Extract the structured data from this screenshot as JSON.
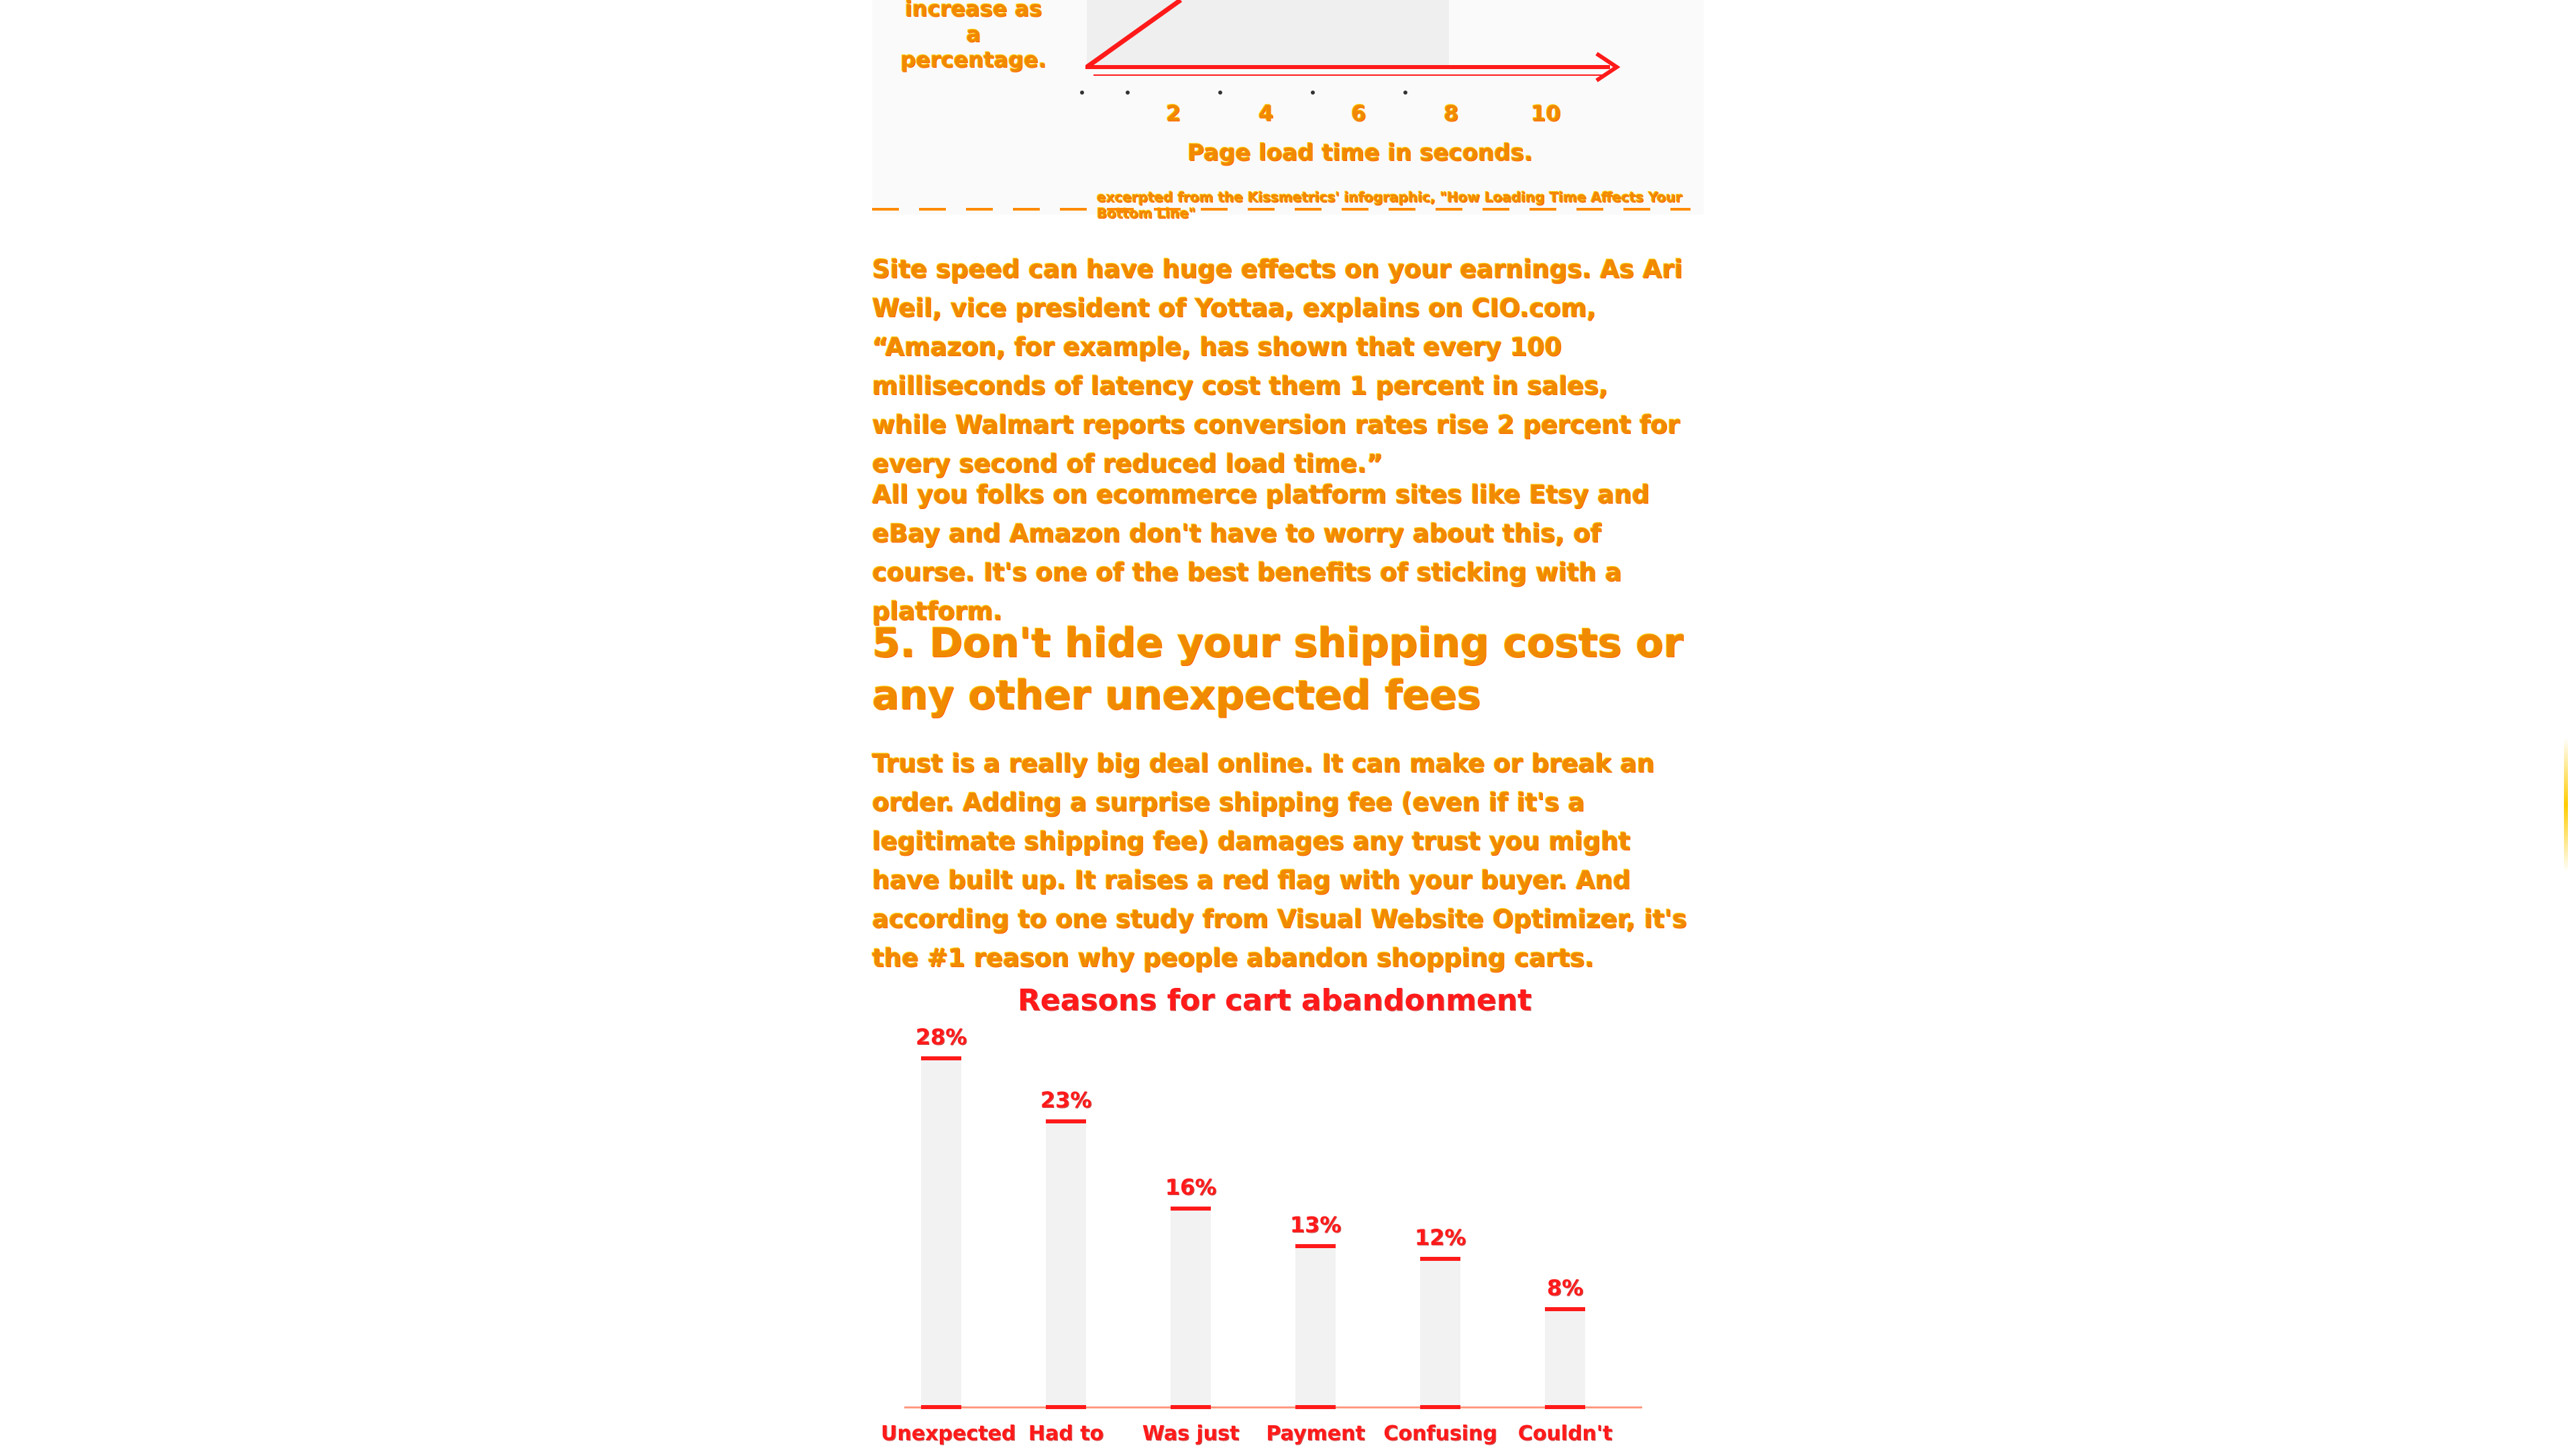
{
  "top_chart": {
    "ylabel_line1": "increase as a",
    "ylabel_line2": "percentage.",
    "x_ticks": [
      "2",
      "4",
      "6",
      "8",
      "10"
    ],
    "xlabel": "Page load time in seconds.",
    "source": "excerpted from the Kissmetrics' infographic, \"How Loading Time Affects Your Bottom Line\""
  },
  "article": {
    "para1": "Site speed can have huge effects on your earnings. As Ari Weil, vice president of Yottaa, explains on CIO.com, “Amazon, for example, has shown that every 100 milliseconds of latency cost them 1 percent in sales, while Walmart reports conversion rates rise 2 percent for every second of reduced load time.”",
    "para2": "All you folks on ecommerce platform sites like Etsy and eBay and Amazon don't have to worry about this, of course. It's one of the best benefits of sticking with a platform.",
    "heading": "5. Don't hide your shipping costs or any other unexpected fees",
    "para3": "Trust is a really big deal online. It can make or break an order. Adding a surprise shipping fee (even if it's a legitimate shipping fee) damages any trust you might have built up. It raises a red flag with your buyer. And according to one study from Visual Website Optimizer, it's the #1 reason why people abandon shopping carts."
  },
  "chart_data": {
    "type": "bar",
    "title": "Reasons for cart abandonment",
    "categories": [
      "Unexpected",
      "Had to",
      "Was just",
      "Payment",
      "Confusing",
      "Couldn't find"
    ],
    "values": [
      28,
      23,
      16,
      13,
      12,
      8
    ],
    "value_labels": [
      "28%",
      "23%",
      "16%",
      "13%",
      "12%",
      "8%"
    ],
    "ylim": [
      0,
      30
    ],
    "bar_color": "#f2f2f2",
    "accent_color": "#ff1a1a"
  },
  "colors": {
    "text": "#f08a00",
    "accent": "#ff1a1a"
  }
}
